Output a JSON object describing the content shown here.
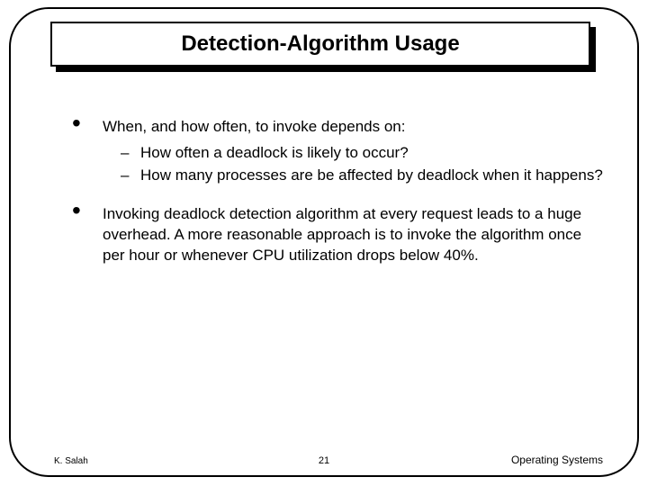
{
  "title": "Detection-Algorithm Usage",
  "bullets": [
    {
      "text": "When, and how often, to invoke depends on:",
      "sub": [
        "How often a deadlock is likely to occur?",
        "How many processes are be affected by deadlock when it happens?"
      ]
    },
    {
      "text": "Invoking deadlock detection algorithm at every request leads to a huge overhead.  A more reasonable approach is to invoke the algorithm once per hour or whenever CPU utilization drops below 40%.",
      "sub": []
    }
  ],
  "footer": {
    "left": "K. Salah",
    "center": "21",
    "right": "Operating Systems"
  }
}
